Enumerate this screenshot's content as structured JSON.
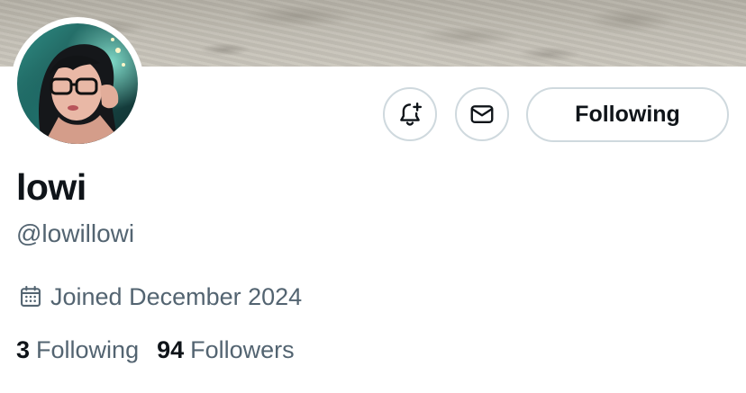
{
  "profile": {
    "display_name": "lowi",
    "handle": "@lowillowi",
    "joined": "Joined December 2024"
  },
  "actions": {
    "notify_icon": "bell-plus-icon",
    "message_icon": "envelope-icon",
    "follow_label": "Following"
  },
  "stats": {
    "following_count": "3",
    "following_label": "Following",
    "followers_count": "94",
    "followers_label": "Followers"
  },
  "colors": {
    "text_primary": "#0f1419",
    "text_secondary": "#536471",
    "border": "#cfd9de",
    "background": "#ffffff"
  }
}
